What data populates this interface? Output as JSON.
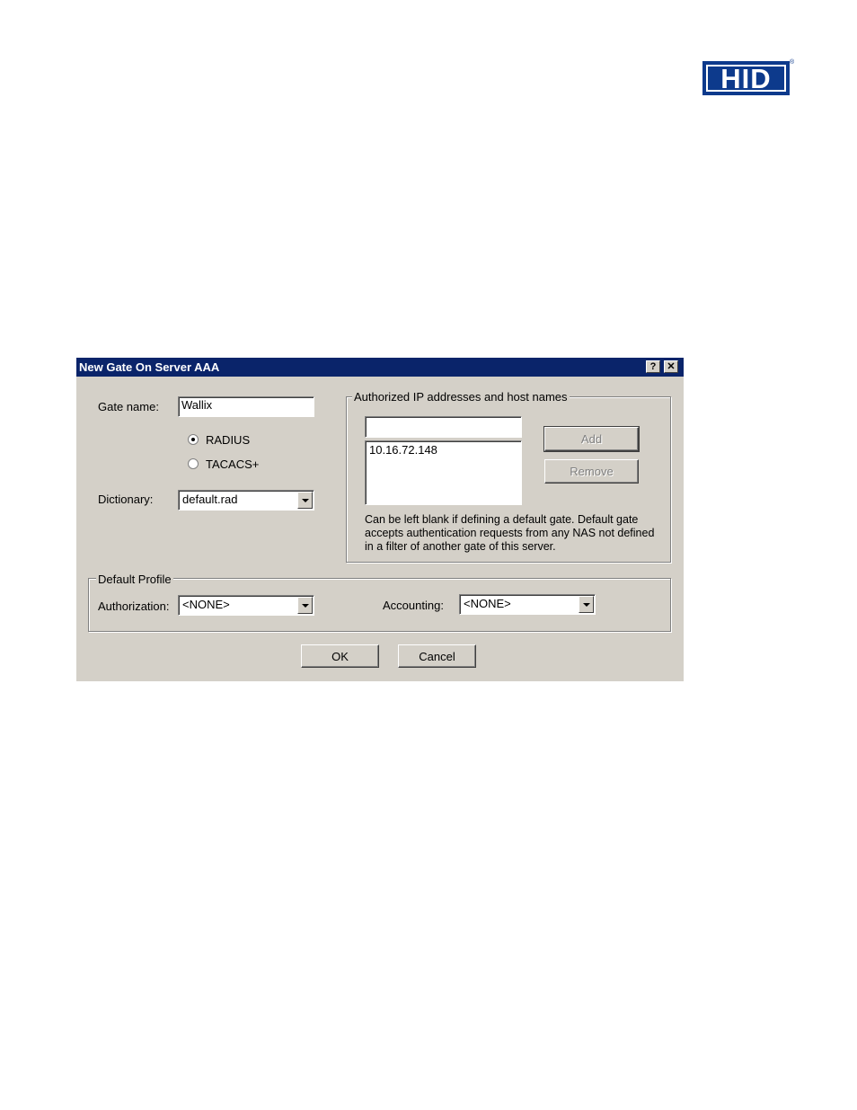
{
  "logo": {
    "text": "HID",
    "reg": "®"
  },
  "dialog": {
    "title": "New Gate On Server AAA",
    "help_glyph": "?",
    "close_glyph": "✕",
    "gate_name_label": "Gate name:",
    "gate_name_value": "Wallix",
    "radio_radius": "RADIUS",
    "radio_tacacs": "TACACS+",
    "selected_protocol": "RADIUS",
    "dictionary_label": "Dictionary:",
    "dictionary_value": "default.rad",
    "authorized": {
      "title": "Authorized IP addresses and host names",
      "input_value": "",
      "list_items": [
        "10.16.72.148"
      ],
      "add_label": "Add",
      "remove_label": "Remove",
      "note": "Can be left blank if defining a default gate. Default gate accepts authentication requests from any NAS not defined in a filter of another gate of this server."
    },
    "default_profile": {
      "title": "Default Profile",
      "authorization_label": "Authorization:",
      "authorization_value": "<NONE>",
      "accounting_label": "Accounting:",
      "accounting_value": "<NONE>"
    },
    "ok_label": "OK",
    "cancel_label": "Cancel"
  },
  "colors": {
    "titlebar": "#0a246a",
    "dialog_bg": "#d4d0c8",
    "logo_blue": "#0d3a8c"
  }
}
